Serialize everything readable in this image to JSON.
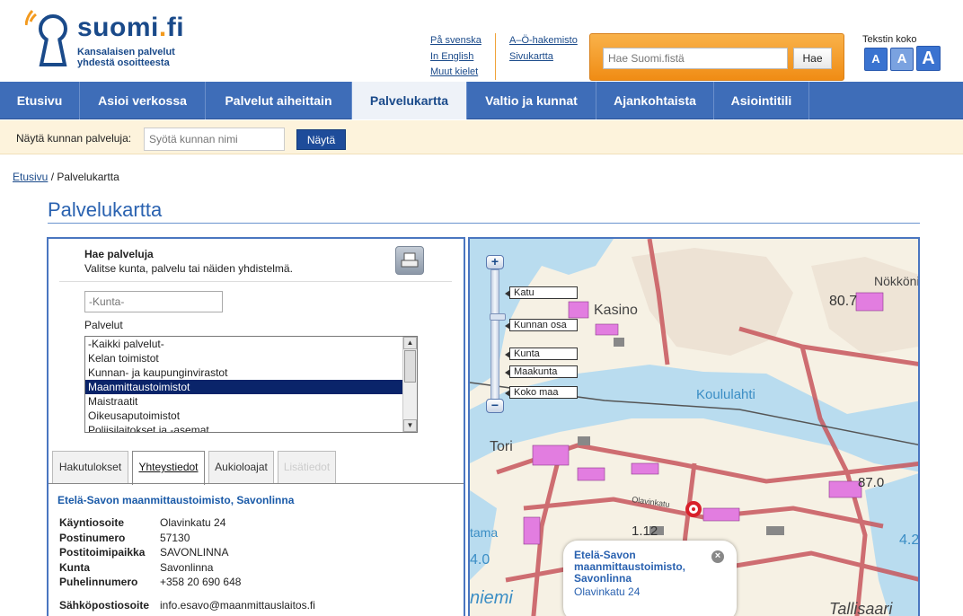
{
  "logo": {
    "name_main": "suomi",
    "name_dot": ".",
    "name_tld": "fi",
    "tagline1": "Kansalaisen palvelut",
    "tagline2": "yhdestä osoitteesta"
  },
  "lang_links": [
    "På svenska",
    "In English",
    "Muut kielet"
  ],
  "site_links": [
    "A–Ö-hakemisto",
    "Sivukartta"
  ],
  "search": {
    "placeholder": "Hae Suomi.fistä",
    "button": "Hae"
  },
  "text_size": {
    "label": "Tekstin koko",
    "small": "A",
    "medium": "A",
    "large": "A"
  },
  "nav": [
    "Etusivu",
    "Asioi verkossa",
    "Palvelut aiheittain",
    "Palvelukartta",
    "Valtio ja kunnat",
    "Ajankohtaista",
    "Asiointitili"
  ],
  "nav_active_index": 3,
  "kunta_bar": {
    "label": "Näytä kunnan palveluja:",
    "placeholder": "Syötä kunnan nimi",
    "button": "Näytä"
  },
  "breadcrumb": {
    "home": "Etusivu",
    "sep": " / ",
    "current": "Palvelukartta"
  },
  "page_title": "Palvelukartta",
  "panel": {
    "title": "Hae palveluja",
    "subtitle": "Valitse kunta, palvelu tai näiden yhdistelmä.",
    "kunta_placeholder": "-Kunta-",
    "services_label": "Palvelut",
    "services": [
      "-Kaikki palvelut-",
      "Kelan toimistot",
      "Kunnan- ja kaupunginvirastot",
      "Maanmittaustoimistot",
      "Maistraatit",
      "Oikeusaputoimistot",
      "Poliisilaitokset ja -asemat"
    ],
    "selected_service": "Maanmittaustoimistot",
    "tabs": [
      "Hakutulokset",
      "Yhteystiedot",
      "Aukioloajat",
      "Lisätiedot"
    ],
    "active_tab": "Yhteystiedot",
    "office_name": "Etelä-Savon maanmittaustoimisto, Savonlinna",
    "details": [
      {
        "key": "Käyntiosoite",
        "value": "Olavinkatu 24"
      },
      {
        "key": "Postinumero",
        "value": "57130"
      },
      {
        "key": "Postitoimipaikka",
        "value": "SAVONLINNA"
      },
      {
        "key": "Kunta",
        "value": "Savonlinna"
      },
      {
        "key": "Puhelinnumero",
        "value": "+358 20 690 648"
      }
    ],
    "email": {
      "key": "Sähköpostiosoite",
      "value": "info.esavo@maanmittauslaitos.fi"
    }
  },
  "map": {
    "zoom_levels": [
      "Katu",
      "Kunnan osa",
      "Kunta",
      "Maakunta",
      "Koko maa"
    ],
    "zoom_in": "+",
    "zoom_out": "−",
    "place_labels": [
      "Kasino",
      "Koululahti",
      "Nökköni",
      "Tori",
      "Olavinkatu",
      "niemi",
      "Tallisaari",
      "tama"
    ],
    "elevation_labels": [
      "80.7",
      "87.0",
      "4.0",
      "4.2",
      "1.12"
    ],
    "popup": {
      "title": "Etelä-Savon maanmittaustoimisto, Savonlinna",
      "address": "Olavinkatu 24",
      "close": "×"
    }
  }
}
